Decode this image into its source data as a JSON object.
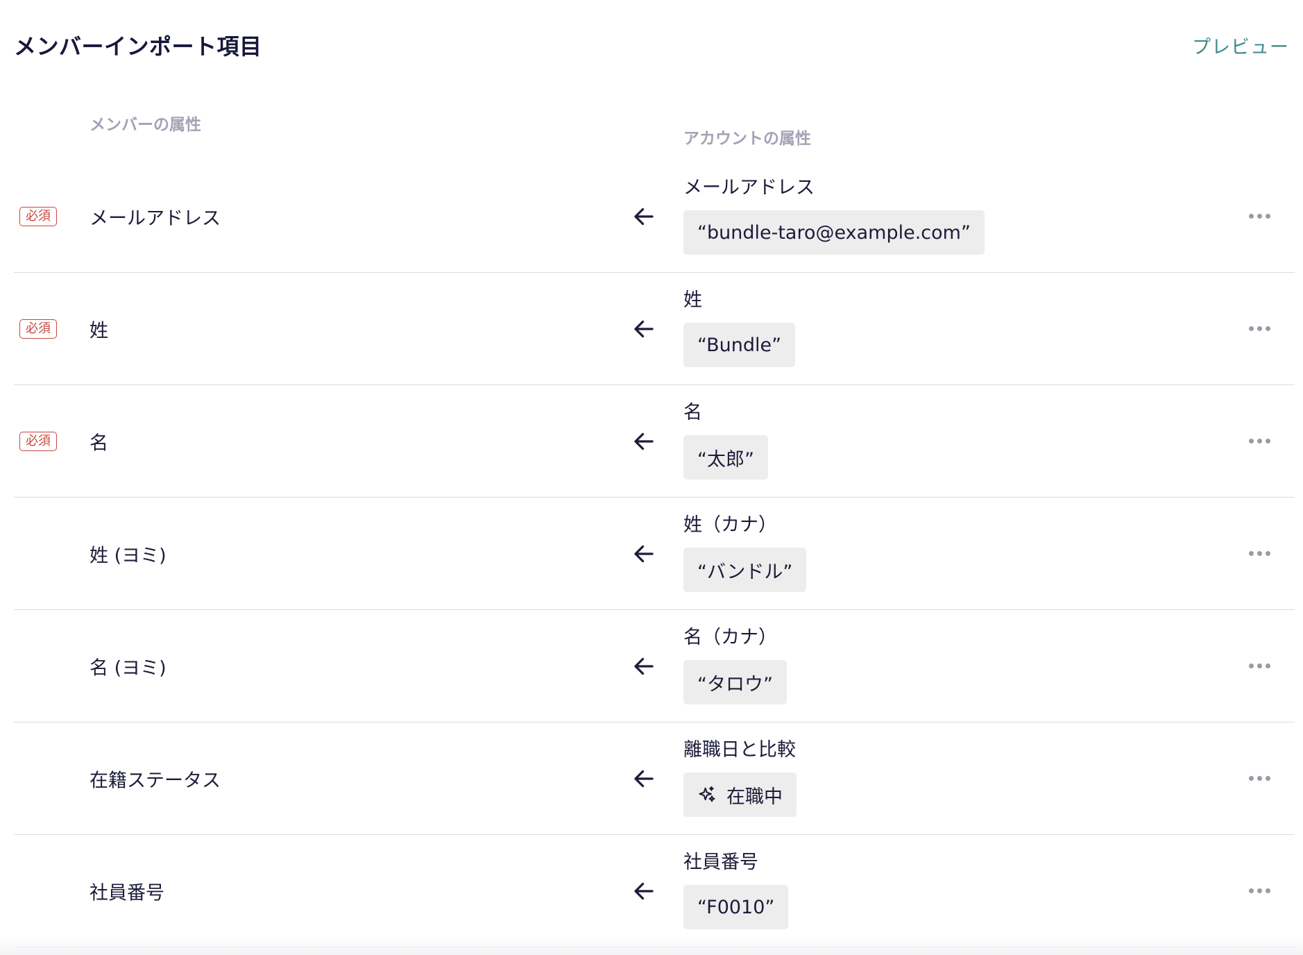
{
  "header": {
    "title": "メンバーインポート項目",
    "preview_label": "プレビュー"
  },
  "columns": {
    "member": "メンバーの属性",
    "account": "アカウントの属性"
  },
  "required_badge": "必須",
  "rows": [
    {
      "member_label": "メールアドレス",
      "required": true,
      "account_label": "メールアドレス",
      "value": "“bundle-taro@example.com”"
    },
    {
      "member_label": "姓",
      "required": true,
      "account_label": "姓",
      "value": "“Bundle”"
    },
    {
      "member_label": "名",
      "required": true,
      "account_label": "名",
      "value": "“太郎”"
    },
    {
      "member_label": "姓 (ヨミ)",
      "required": false,
      "account_label": "姓（カナ）",
      "value": "“バンドル”"
    },
    {
      "member_label": "名 (ヨミ)",
      "required": false,
      "account_label": "名（カナ）",
      "value": "“タロウ”"
    },
    {
      "member_label": "在籍ステータス",
      "required": false,
      "account_label": "離職日と比較",
      "value": "在職中",
      "value_icon": "sparkle-icon"
    },
    {
      "member_label": "社員番号",
      "required": false,
      "account_label": "社員番号",
      "value": "“F0010”"
    }
  ],
  "colors": {
    "title": "#17173a",
    "link": "#3c8c8c",
    "required": "#c8463c",
    "chip_bg": "#ededed",
    "muted": "#a3a3b5"
  }
}
